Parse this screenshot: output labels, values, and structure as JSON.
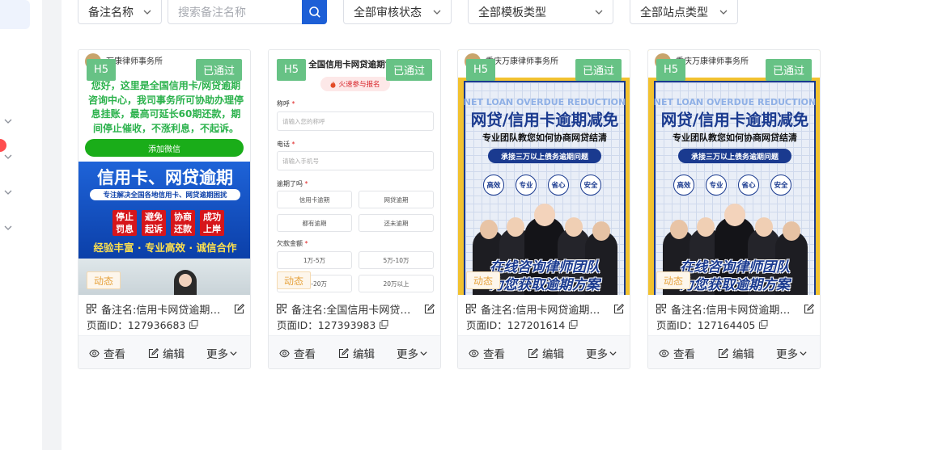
{
  "filters": {
    "note_select": "备注名称",
    "search_placeholder": "搜索备注名称",
    "audit_status": "全部审核状态",
    "template_type": "全部模板类型",
    "site_type": "全部站点类型"
  },
  "colors": {
    "accent": "#1d5fd6",
    "tag_green": "#67c285",
    "tag_orange": "#e6a23c",
    "badge_red": "#ff4d4f"
  },
  "common": {
    "h5_tag": "H5",
    "status_tag": "已通过",
    "dynamic_tag": "动态",
    "view": "查看",
    "edit": "编辑",
    "more": "更多"
  },
  "cards": [
    {
      "note": "备注名:信用卡网贷逾期咨询",
      "page_id": "页面ID：127936683",
      "thumb": {
        "firm": "万康律师事务所",
        "intro": "您好，这里是全国信用卡/网贷逾期咨询中心，我司事务所可协助办理停息挂账，最高可延长60期还款，期间停止催收，不涨利息，不起诉。",
        "button": "添加微信",
        "banner_title": "信用卡、网贷逾期",
        "banner_sub": "专注解决全国各地信用卡、网贷逾期困扰",
        "boxes": [
          "停止罚息",
          "避免起诉",
          "协商还款",
          "成功上岸"
        ],
        "slogan": "经验丰富 · 专业高效 · 诚信合作"
      }
    },
    {
      "note": "备注名:全国信用卡网贷逾期协商",
      "page_id": "页面ID：127393983",
      "thumb": {
        "title": "全国信用卡网贷逾期协商",
        "pill": "火速参与报名",
        "label_name": "称呼",
        "ph_name": "请输入您的称呼",
        "label_phone": "电话",
        "ph_phone": "请输入手机号",
        "label_overdue": "逾期了吗",
        "opts1": [
          "信用卡逾期",
          "网贷逾期",
          "都有逾期",
          "还未逾期"
        ],
        "label_amount": "欠款金额",
        "opts2": [
          "1万-5万",
          "5万-10万",
          "10万-20万",
          "20万以上"
        ]
      }
    },
    {
      "note": "备注名:信用卡网贷逾期减免",
      "page_id": "页面ID：127201614",
      "thumb": {
        "firm": "重庆万康律师事务所",
        "en": "NET LOAN OVERDUE REDUCTION",
        "title": "网贷/信用卡逾期减免",
        "sub": "专业团队教您如何协商网贷结清",
        "pill": "承接三万以上债务逾期问题",
        "circles": [
          "高效",
          "专业",
          "省心",
          "安全"
        ],
        "team": "在线咨询律师团队",
        "plan": "为您获取逾期方案"
      }
    },
    {
      "note": "备注名:信用卡网贷逾期减免",
      "page_id": "页面ID：127164405",
      "thumb": {
        "firm": "重庆万康律师事务所",
        "en": "NET LOAN OVERDUE REDUCTION",
        "title": "网贷/信用卡逾期减免",
        "sub": "专业团队教您如何协商网贷结清",
        "pill": "承接三万以上债务逾期问题",
        "circles": [
          "高效",
          "专业",
          "省心",
          "安全"
        ],
        "team": "在线咨询律师团队",
        "plan": "为您获取逾期方案"
      }
    }
  ]
}
